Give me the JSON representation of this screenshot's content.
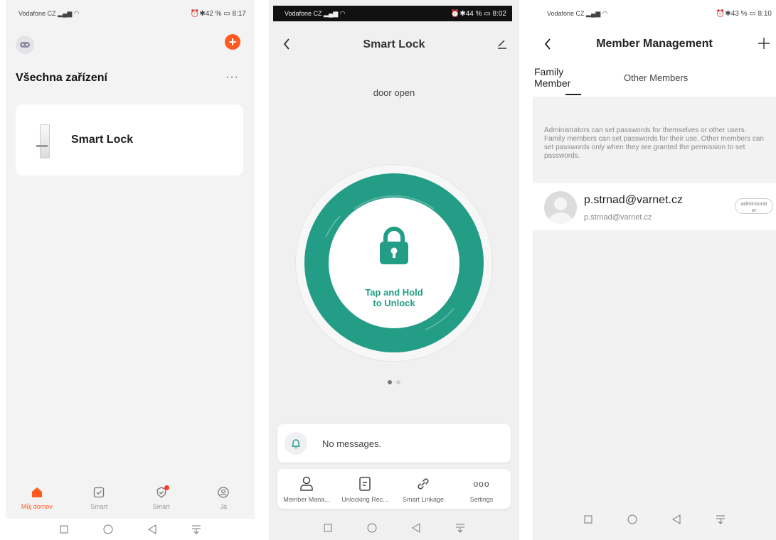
{
  "screens": [
    {
      "status": {
        "carrier": "Vodafone CZ",
        "battery": "42 %",
        "time": "8:17"
      },
      "title": "Všechna zařízení",
      "more": "···",
      "device": {
        "name": "Smart Lock"
      },
      "tabs": [
        {
          "label": "Můj domov",
          "icon": "home-icon",
          "active": true
        },
        {
          "label": "Smart",
          "icon": "checkbox-icon",
          "active": false
        },
        {
          "label": "Smart",
          "icon": "shield-check-icon",
          "active": false,
          "badge": true
        },
        {
          "label": "Já",
          "icon": "profile-icon",
          "active": false
        }
      ]
    },
    {
      "status": {
        "carrier": "Vodafone CZ",
        "battery": "44 %",
        "time": "8:02"
      },
      "title": "Smart Lock",
      "state": "door open",
      "unlock_label": "Tap and Hold\nto Unlock",
      "message": "No messages.",
      "actions": [
        {
          "label": "Member Mana...",
          "icon": "person-icon"
        },
        {
          "label": "Unlocking Rec...",
          "icon": "document-icon"
        },
        {
          "label": "Smart Linkage",
          "icon": "link-icon"
        },
        {
          "label": "Settings",
          "icon": "ellipsis-icon",
          "glyph": "ooo"
        }
      ]
    },
    {
      "status": {
        "carrier": "Vodafone CZ",
        "battery": "43 %",
        "time": "8:10"
      },
      "title": "Member Management",
      "tabs": {
        "family": "Family\nMember",
        "other": "Other Members"
      },
      "info": "Administrators can set passwords for themselves or other users. Family members can set passwords for their use. Other members can set passwords only when they are granted the permission to set passwords.",
      "member": {
        "name": "p.strnad@varnet.cz",
        "email": "p.strnad@varnet.cz",
        "role": "administrat\nor"
      }
    }
  ],
  "colors": {
    "accent_orange": "#ff5a1f",
    "lock_green": "#249d86",
    "badge_red": "#ff3b30"
  }
}
